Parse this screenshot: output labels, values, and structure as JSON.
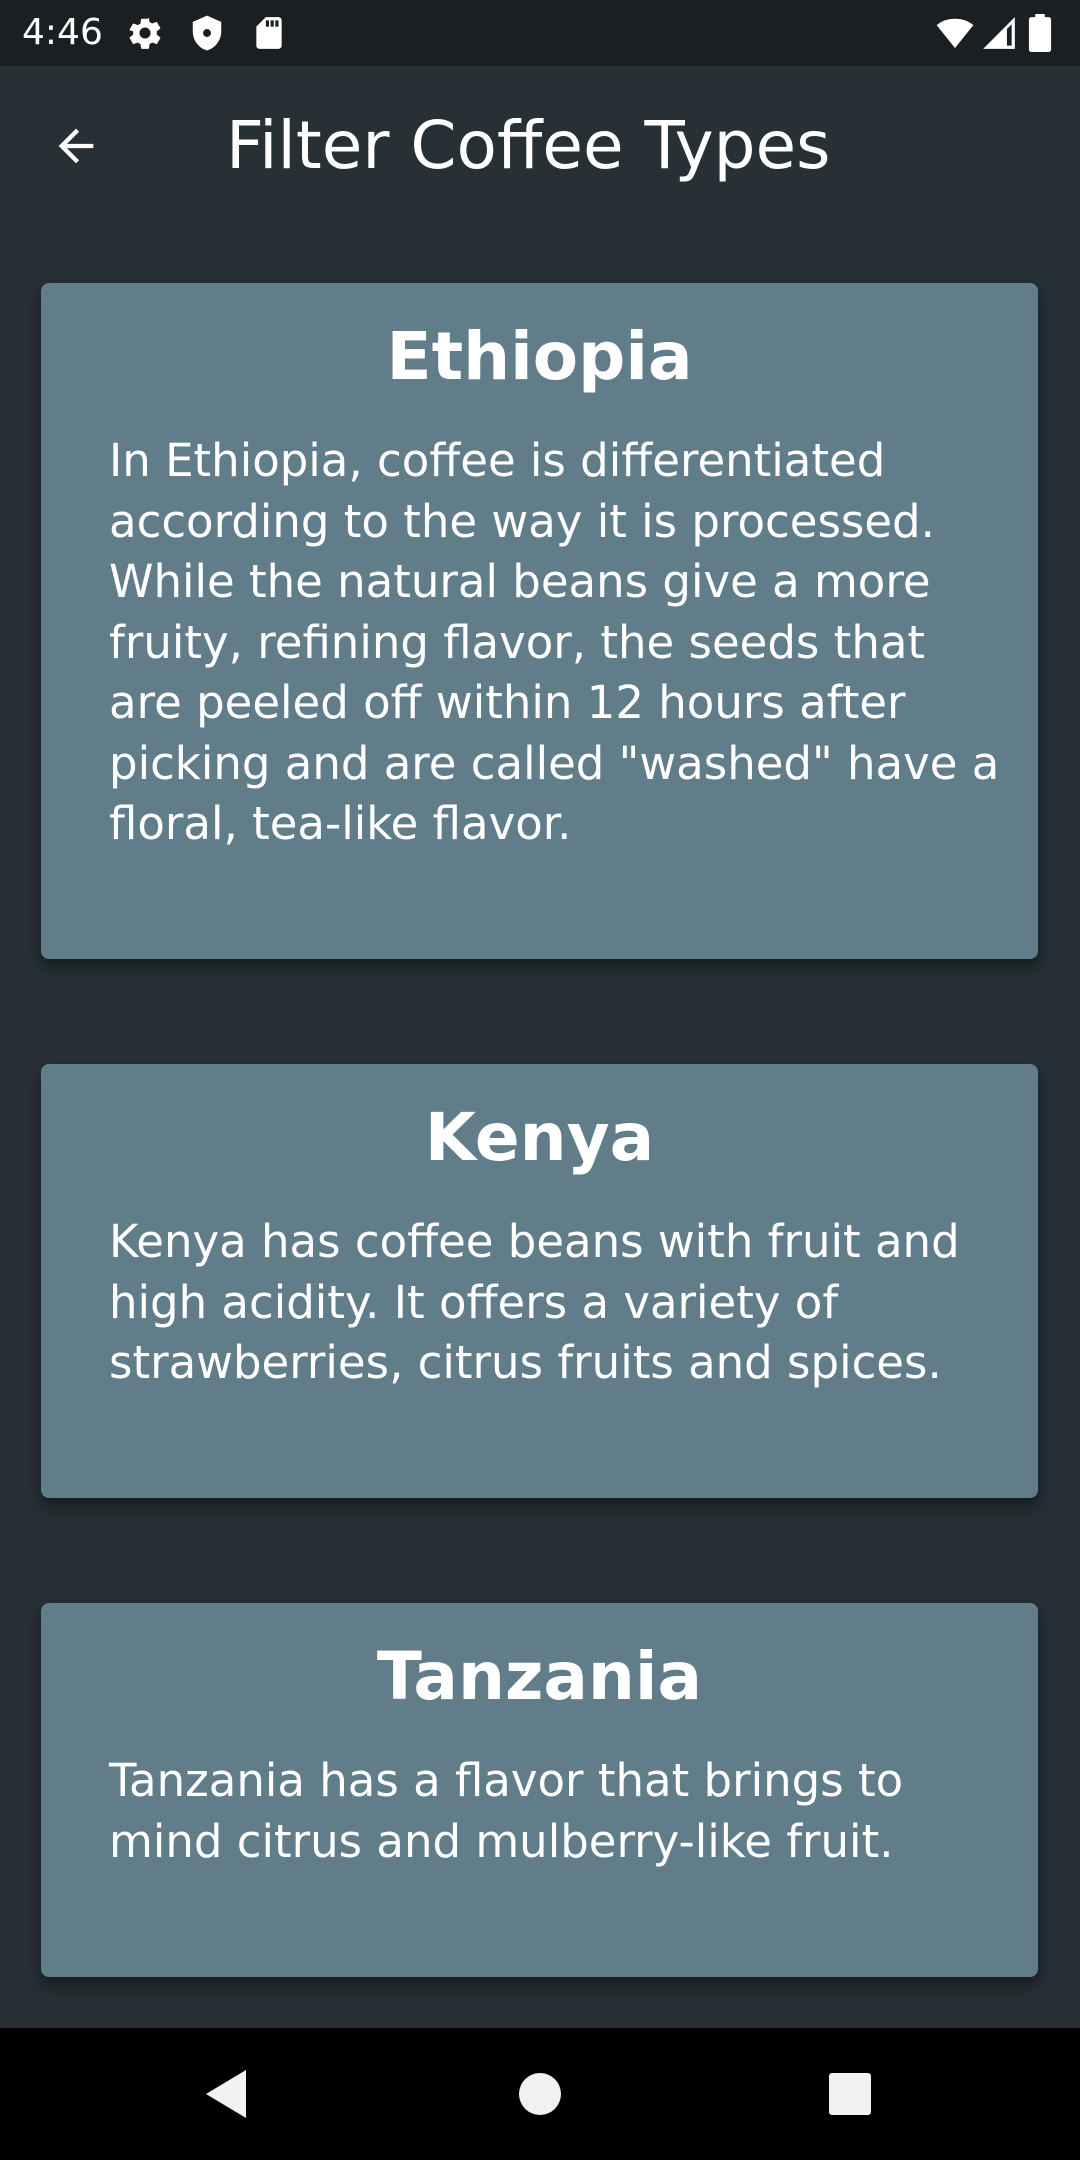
{
  "status_bar": {
    "time": "4:46",
    "left_icons": [
      "gear-icon",
      "shield-icon",
      "sd-card-icon"
    ],
    "right_icons": [
      "wifi-icon",
      "signal-icon",
      "battery-icon"
    ]
  },
  "app_bar": {
    "title": "Filter Coffee Types",
    "back_icon": "arrow-left-icon"
  },
  "cards": [
    {
      "title": "Ethiopia",
      "text": "In Ethiopia, coffee is differentiated according to the way it is processed. While the natural beans give a more fruity, refining flavor, the seeds that are peeled off within 12 hours after picking and are called \"washed\" have a floral, tea-like flavor."
    },
    {
      "title": "Kenya",
      "text": "Kenya has coffee beans with fruit and high acidity. It offers a variety of strawberries, citrus fruits and spices."
    },
    {
      "title": "Tanzania",
      "text": "Tanzania has a flavor that brings to mind citrus and mulberry-like fruit."
    }
  ],
  "nav_bar": {
    "buttons": [
      "back-triangle-icon",
      "home-circle-icon",
      "recents-square-icon"
    ]
  },
  "colors": {
    "background": "#263035",
    "card": "#617d8a",
    "status_bar": "#1b1f21",
    "nav_bar": "#000000",
    "text": "#ffffff"
  }
}
